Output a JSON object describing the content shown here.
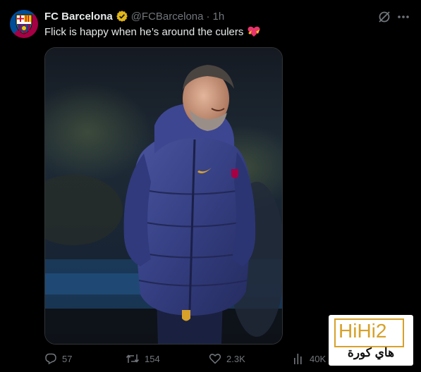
{
  "account": {
    "name": "FC Barcelona",
    "handle": "@FCBarcelona",
    "separator": "·",
    "time": "1h"
  },
  "tweet": {
    "text": "Flick is happy when he’s around the culers"
  },
  "actions": {
    "replies": "57",
    "reposts": "154",
    "likes": "2.3K",
    "views": "40K"
  },
  "watermark": {
    "logo_text": "HiHi2",
    "arabic_text": "هاي كورة"
  },
  "colors": {
    "background": "#000000",
    "text": "#e7e9ea",
    "muted": "#71767b",
    "verified_gold": "#e2b719",
    "barca_blue": "#004d98",
    "barca_red": "#a50044",
    "watermark_gold": "#d7a12a"
  },
  "icons": {
    "verified": "verified-badge-icon",
    "grok": "grok-icon",
    "more": "more-icon",
    "reply": "reply-icon",
    "repost": "repost-icon",
    "like": "heart-icon",
    "views": "views-icon",
    "emoji": "heart-with-ribbon-emoji"
  }
}
